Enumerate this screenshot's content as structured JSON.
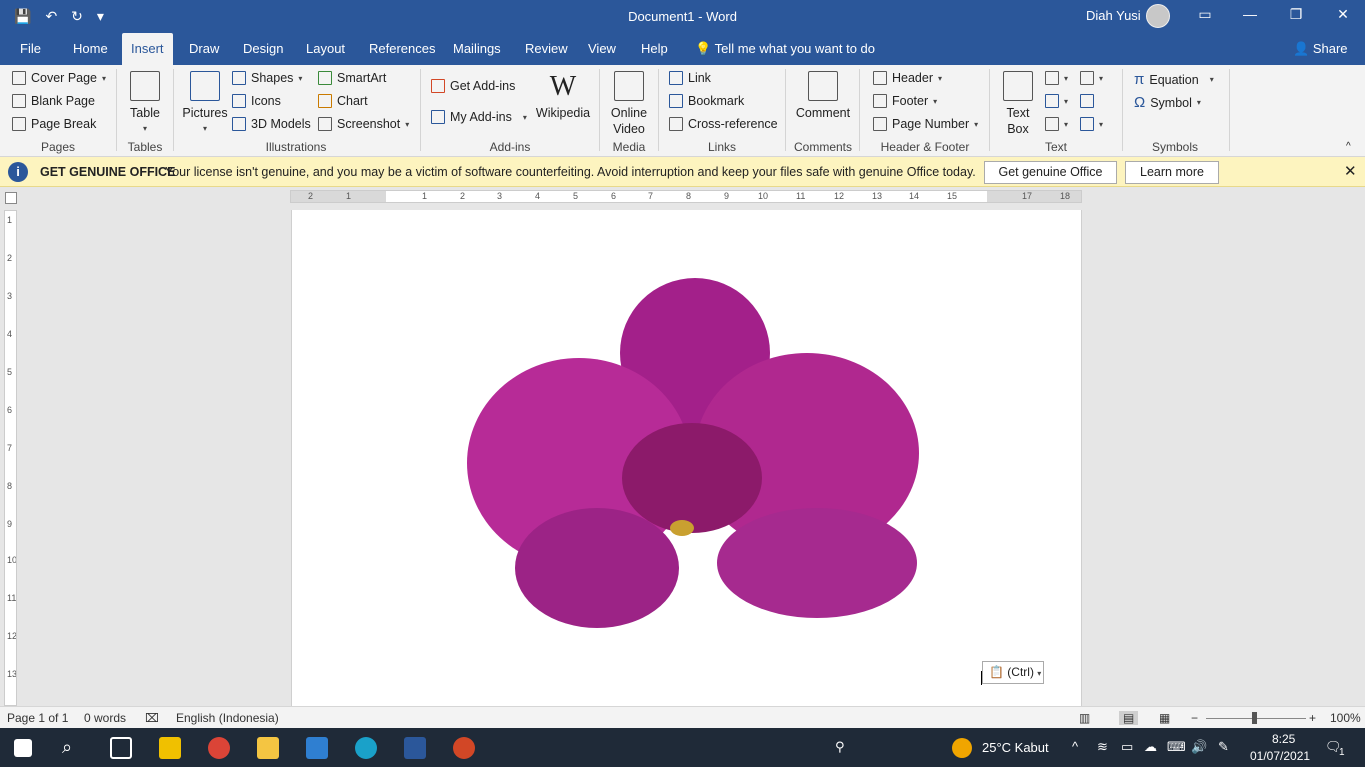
{
  "titlebar": {
    "title": "Document1  -  Word",
    "user": "Diah Yusi",
    "minimize": "—",
    "restore": "❐",
    "close": "✕",
    "qat_save": "💾",
    "qat_undo": "↶",
    "qat_redo": "↻",
    "qat_more": "▾"
  },
  "tabs": [
    "File",
    "Home",
    "Insert",
    "Draw",
    "Design",
    "Layout",
    "References",
    "Mailings",
    "Review",
    "View",
    "Help"
  ],
  "active_tab": "Insert",
  "tell_me": "Tell me what you want to do",
  "share": "Share",
  "ribbon": {
    "pages": {
      "label": "Pages",
      "cover_page": "Cover Page",
      "blank_page": "Blank Page",
      "page_break": "Page Break"
    },
    "tables": {
      "label": "Tables",
      "table": "Table"
    },
    "illustrations": {
      "label": "Illustrations",
      "pictures": "Pictures",
      "shapes": "Shapes",
      "icons": "Icons",
      "models": "3D Models",
      "smartart": "SmartArt",
      "chart": "Chart",
      "screenshot": "Screenshot"
    },
    "addins": {
      "label": "Add-ins",
      "get_addins": "Get Add-ins",
      "my_addins": "My Add-ins",
      "wikipedia": "Wikipedia",
      "wiki_glyph": "W"
    },
    "media": {
      "label": "Media",
      "online_video_1": "Online",
      "online_video_2": "Video"
    },
    "links": {
      "label": "Links",
      "link": "Link",
      "bookmark": "Bookmark",
      "cross_reference": "Cross-reference"
    },
    "comments": {
      "label": "Comments",
      "comment": "Comment"
    },
    "header_footer": {
      "label": "Header & Footer",
      "header": "Header",
      "footer": "Footer",
      "page_number": "Page Number"
    },
    "text": {
      "label": "Text",
      "text_box_1": "Text",
      "text_box_2": "Box"
    },
    "symbols": {
      "label": "Symbols",
      "equation": "Equation",
      "symbol": "Symbol",
      "equation_glyph": "π",
      "symbol_glyph": "Ω"
    }
  },
  "infobar": {
    "icon": "i",
    "title": "GET GENUINE OFFICE",
    "message": "Your license isn't genuine, and you may be a victim of software counterfeiting. Avoid interruption and keep your files safe with genuine Office today.",
    "get_button": "Get genuine Office",
    "learn_button": "Learn more",
    "close": "✕"
  },
  "ruler": {
    "h_labels": [
      "2",
      "1",
      "1",
      "2",
      "3",
      "4",
      "5",
      "6",
      "7",
      "8",
      "9",
      "10",
      "11",
      "12",
      "13",
      "14",
      "15",
      "17",
      "18"
    ],
    "v_labels": [
      "1",
      "2",
      "3",
      "4",
      "5",
      "6",
      "7",
      "8",
      "9",
      "10",
      "11",
      "12",
      "13"
    ]
  },
  "document": {
    "paste_tag": "(Ctrl)"
  },
  "statusbar": {
    "page": "Page 1 of 1",
    "words": "0 words",
    "language": "English (Indonesia)",
    "zoom": "100%",
    "zoom_minus": "−",
    "zoom_plus": "+"
  },
  "taskbar": {
    "weather": "25°C  Kabut",
    "time": "8:25",
    "date": "01/07/2021",
    "notification_count": "1"
  },
  "colors": {
    "word_blue": "#2b579a",
    "infobar": "#fdf4bf",
    "orchid": "#b0238f"
  }
}
